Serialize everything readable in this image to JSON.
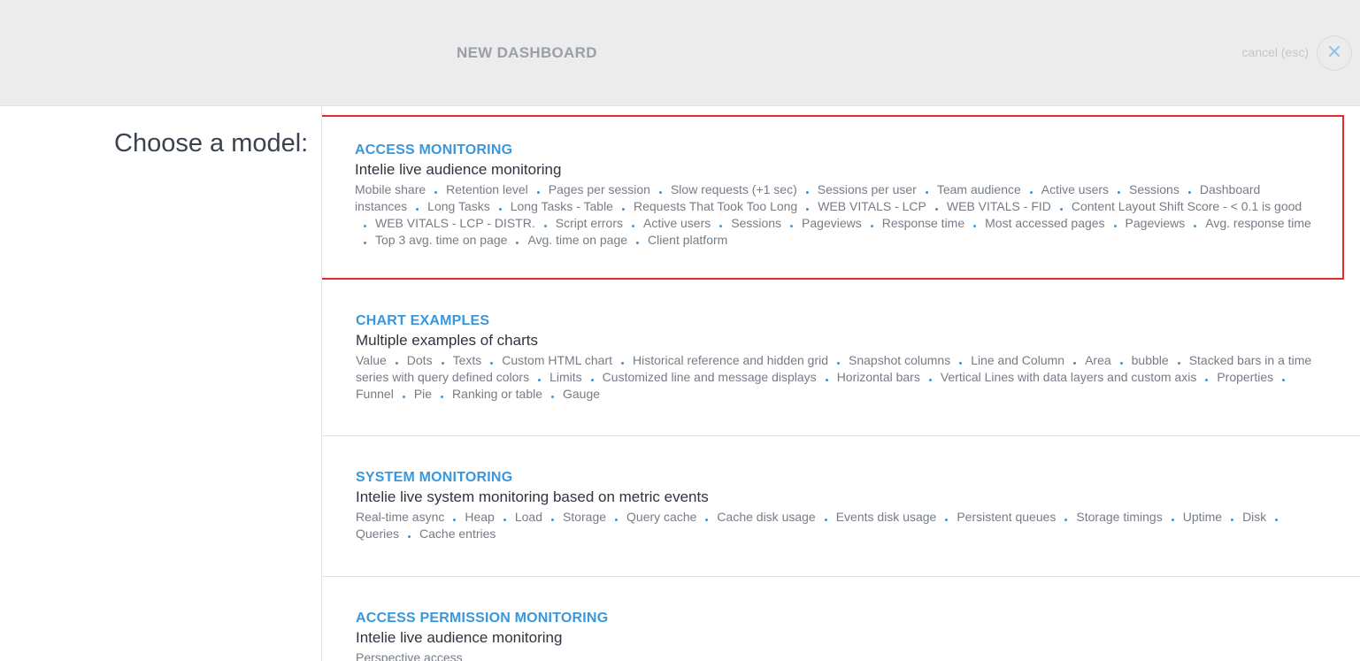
{
  "header": {
    "title": "NEW DASHBOARD",
    "cancel_label": "cancel (esc)",
    "close_icon": "close-icon"
  },
  "prompt": "Choose a model:",
  "colors": {
    "accent": "#3a97dc",
    "selection": "#e12b2b",
    "header_bg": "#ececec"
  },
  "models": [
    {
      "name": "ACCESS MONITORING",
      "description": "Intelie live audience monitoring",
      "selected": true,
      "tags": [
        "Mobile share",
        "Retention level",
        "Pages per session",
        "Slow requests (+1 sec)",
        "Sessions per user",
        "Team audience",
        "Active users",
        "Sessions",
        "Dashboard instances",
        "Long Tasks",
        "Long Tasks - Table",
        "Requests That Took Too Long",
        "WEB VITALS - LCP",
        "WEB VITALS - FID",
        "Content Layout Shift Score - < 0.1 is good",
        "WEB VITALS - LCP - DISTR.",
        "Script errors",
        "Active users",
        "Sessions",
        "Pageviews",
        "Response time",
        "Most accessed pages",
        "Pageviews",
        "Avg. response time",
        "Top 3 avg. time on page",
        "Avg. time on page",
        "Client platform"
      ]
    },
    {
      "name": "CHART EXAMPLES",
      "description": "Multiple examples of charts",
      "selected": false,
      "tags": [
        "Value",
        "Dots",
        "Texts",
        "Custom HTML chart",
        "Historical reference and hidden grid",
        "Snapshot columns",
        "Line and Column",
        "Area",
        "bubble",
        "Stacked bars in a time series with query defined colors",
        "Limits",
        "Customized line and message displays",
        "Horizontal bars",
        "Vertical Lines with data layers and custom axis",
        "Properties",
        "Funnel",
        "Pie",
        "Ranking or table",
        "Gauge"
      ]
    },
    {
      "name": "SYSTEM MONITORING",
      "description": "Intelie live system monitoring based on metric events",
      "selected": false,
      "tags": [
        "Real-time async",
        "Heap",
        "Load",
        "Storage",
        "Query cache",
        "Cache disk usage",
        "Events disk usage",
        "Persistent queues",
        "Storage timings",
        "Uptime",
        "Disk",
        "Queries",
        "Cache entries"
      ]
    },
    {
      "name": "ACCESS PERMISSION MONITORING",
      "description": "Intelie live audience monitoring",
      "selected": false,
      "tags": [
        "Perspective access"
      ]
    }
  ]
}
